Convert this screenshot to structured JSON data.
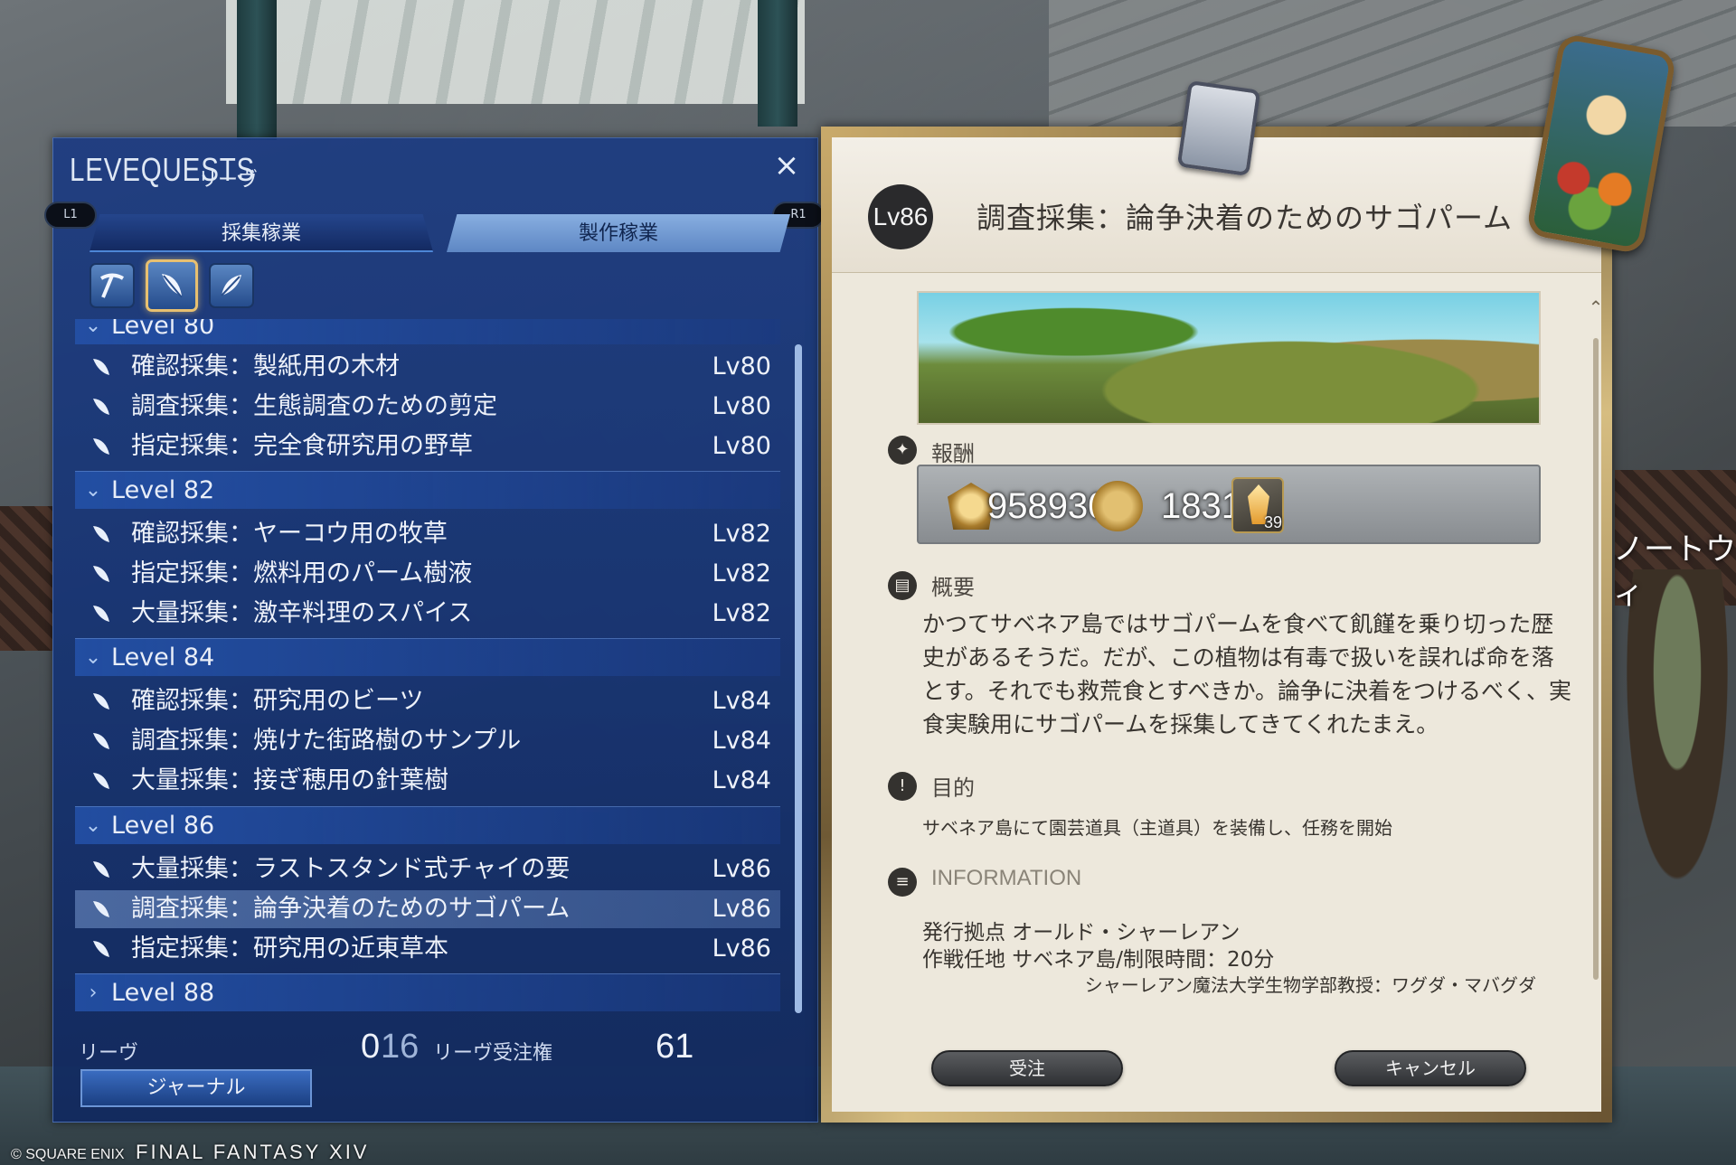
{
  "window": {
    "title": "LEVEQUESTS",
    "subtitle": "リーヴ",
    "close_label": "×",
    "shoulder_left": "L1",
    "shoulder_right": "R1"
  },
  "tabs": [
    {
      "label": "採集稼業",
      "active": true
    },
    {
      "label": "製作稼業",
      "active": false
    }
  ],
  "tools": [
    {
      "icon": "pickaxe-icon",
      "selected": false
    },
    {
      "icon": "hatchet-icon",
      "selected": true
    },
    {
      "icon": "fishing-feather-icon",
      "selected": false
    }
  ],
  "levels": [
    {
      "header": "Level 80",
      "expanded": true,
      "quests": [
        {
          "name": "確認採集：製紙用の木材",
          "level": "Lv80"
        },
        {
          "name": "調査採集：生態調査のための剪定",
          "level": "Lv80"
        },
        {
          "name": "指定採集：完全食研究用の野草",
          "level": "Lv80"
        }
      ]
    },
    {
      "header": "Level 82",
      "expanded": true,
      "quests": [
        {
          "name": "確認採集：ヤーコウ用の牧草",
          "level": "Lv82"
        },
        {
          "name": "指定採集：燃料用のパーム樹液",
          "level": "Lv82"
        },
        {
          "name": "大量採集：激辛料理のスパイス",
          "level": "Lv82"
        }
      ]
    },
    {
      "header": "Level 84",
      "expanded": true,
      "quests": [
        {
          "name": "確認採集：研究用のビーツ",
          "level": "Lv84"
        },
        {
          "name": "調査採集：焼けた街路樹のサンプル",
          "level": "Lv84"
        },
        {
          "name": "大量採集：接ぎ穂用の針葉樹",
          "level": "Lv84"
        }
      ]
    },
    {
      "header": "Level 86",
      "expanded": true,
      "quests": [
        {
          "name": "大量採集：ラストスタンド式チャイの要",
          "level": "Lv86"
        },
        {
          "name": "調査採集：論争決着のためのサゴパーム",
          "level": "Lv86",
          "selected": true
        },
        {
          "name": "指定採集：研究用の近東草本",
          "level": "Lv86"
        }
      ]
    },
    {
      "header": "Level 88",
      "expanded": false,
      "quests": []
    }
  ],
  "footer": {
    "leves_label": "リーヴ",
    "leves_count": "0",
    "leves_max": "16",
    "allowance_label": "リーヴ受注権",
    "allowance_value": "61",
    "journal_button": "ジャーナル"
  },
  "detail": {
    "level_badge": "Lv86",
    "title": "調査採集：論争決着のためのサゴパーム",
    "rewards_label": "報酬",
    "rewards": {
      "gil": "958930",
      "seals": "1831",
      "crystal_count": "39"
    },
    "summary_label": "概要",
    "summary": "かつてサベネア島ではサゴパームを食べて飢饉を乗り切った歴史があるそうだ。だが、この植物は有毒で扱いを誤れば命を落とす。それでも救荒食とすべきか。論争に決着をつけるべく、実食実験用にサゴパームを採集してきてくれたまえ。",
    "objective_label": "目的",
    "objective": "サベネア島にて園芸道具（主道具）を装備し、任務を開始",
    "info_label": "INFORMATION",
    "info_issue": "発行拠点 オールド・シャーレアン",
    "info_area": "作戦任地 サベネア島/制限時間：20分",
    "issuer": "シャーレアン魔法大学生物学部教授：ワグダ・マバグダ",
    "accept_button": "受注",
    "cancel_button": "キャンセル"
  },
  "copyright": {
    "company": "© SQUARE ENIX",
    "game": "FINAL FANTASY XIV"
  },
  "background": {
    "right_text": "ノートウィ"
  }
}
